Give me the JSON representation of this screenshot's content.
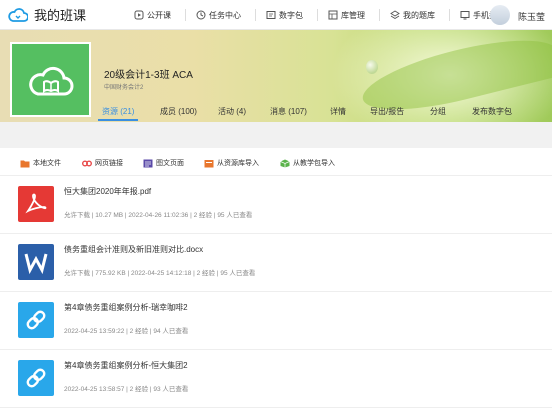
{
  "brand": {
    "title": "我的班课",
    "icon": "cloud-logo-icon",
    "color": "#1f9be3"
  },
  "nav": [
    {
      "label": "公开课",
      "icon": "video-icon"
    },
    {
      "label": "任务中心",
      "icon": "task-icon"
    },
    {
      "label": "数字包",
      "icon": "package-icon"
    },
    {
      "label": "库管理",
      "icon": "library-icon"
    },
    {
      "label": "我的题库",
      "icon": "layers-icon"
    },
    {
      "label": "手机投屏",
      "icon": "screen-cast-icon"
    }
  ],
  "user": {
    "name": "陈玉莹"
  },
  "course": {
    "title": "20级会计1-3班 ACA",
    "subtitle": "中国财务会计2",
    "logo_color": "#55bf61"
  },
  "tabs": [
    {
      "label": "资源 (21)",
      "active": true
    },
    {
      "label": "成员 (100)"
    },
    {
      "label": "活动 (4)"
    },
    {
      "label": "消息 (107)"
    },
    {
      "label": "详情"
    },
    {
      "label": "导出/报告"
    },
    {
      "label": "分组"
    },
    {
      "label": "发布数字包"
    }
  ],
  "toolbar": [
    {
      "label": "本地文件",
      "icon": "folder-icon",
      "color": "#e8762c"
    },
    {
      "label": "网页链接",
      "icon": "link-icon",
      "color": "#e84a4a"
    },
    {
      "label": "图文页面",
      "icon": "image-text-icon",
      "color": "#5b4aa8"
    },
    {
      "label": "从资源库导入",
      "icon": "import-library-icon",
      "color": "#e8762c"
    },
    {
      "label": "从教学包导入",
      "icon": "import-package-icon",
      "color": "#5ab34a"
    }
  ],
  "files": [
    {
      "name": "恒大集团2020年年报.pdf",
      "meta": "允许下载  |  10.27 MB  |  2022-04-26 11:02:36  |  2 经验  |  95 人已查看",
      "type": "pdf",
      "icon": "pdf-icon",
      "color": "#e53935"
    },
    {
      "name": "债务重组会计准则及新旧准则对比.docx",
      "meta": "允许下载  |  775.92 KB  |  2022-04-25 14:12:18  |  2 经验  |  95 人已查看",
      "type": "word",
      "icon": "word-icon",
      "color": "#2b5fa9"
    },
    {
      "name": "第4章债务重组案例分析-瑞幸咖啡2",
      "meta": "2022-04-25 13:59:22  |  2 经验  |  94 人已查看",
      "type": "link",
      "icon": "link-icon",
      "color": "#29a7ea"
    },
    {
      "name": "第4章债务重组案例分析-恒大集团2",
      "meta": "2022-04-25 13:58:57  |  2 经验  |  93 人已查看",
      "type": "link",
      "icon": "link-icon",
      "color": "#29a7ea"
    }
  ]
}
